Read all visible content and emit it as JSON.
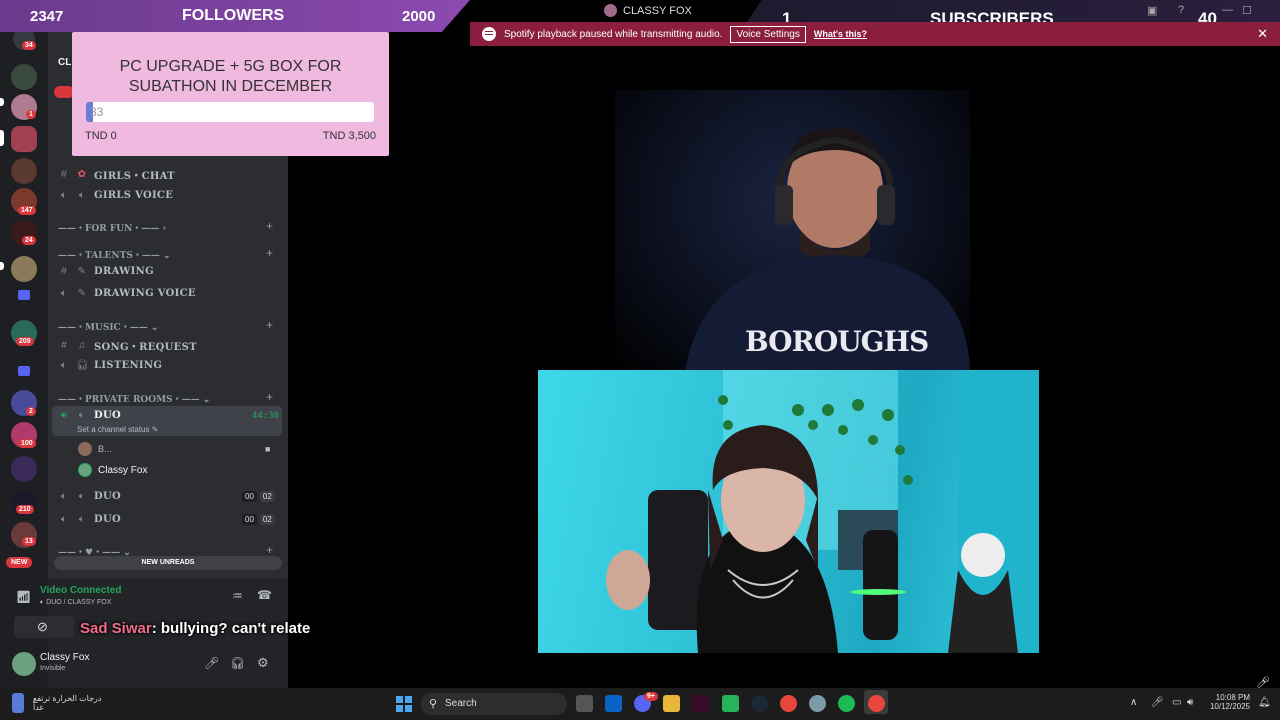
{
  "followers": {
    "current": "2347",
    "label": "FOLLOWERS",
    "goal": "2000"
  },
  "subscribers": {
    "current": "1",
    "label": "SUBSCRIBERS",
    "goal": "40"
  },
  "window": {
    "title": "CLASSY FOX"
  },
  "spotify_notice": {
    "text": "Spotify playback paused while transmitting audio.",
    "button": "Voice Settings",
    "link": "What's this?"
  },
  "goal": {
    "title_line1": "PC UPGRADE + 5G BOX FOR",
    "title_line2": "SUBATHON IN DECEMBER",
    "current": "33",
    "min_label": "TND 0",
    "max_label": "TND 3,500",
    "progress_fraction": 0.0094
  },
  "servers": {
    "badges": [
      "34",
      "1",
      "147",
      "24",
      "209",
      "2",
      "100",
      "210",
      "13",
      "NEW"
    ]
  },
  "channels": {
    "header_partial": "CL",
    "girls_chat": "GIRLS・CHAT",
    "girls_voice": "GIRLS VOICE",
    "cat_fun": "FOR FUN",
    "cat_talents": "TALENTS",
    "drawing": "DRAWING",
    "drawing_voice": "DRAWING VOICE",
    "cat_music": "MUSIC",
    "song_request": "SONG・REQUEST",
    "listening": "LISTENING",
    "cat_private": "PRIVATE ROOMS",
    "duo_active": "DUO",
    "duo_timer": "44:30",
    "duo_status": "Set a channel status",
    "member1": "B...",
    "member2": "Classy Fox",
    "duo2": "DUO",
    "duo2_count_a": "00",
    "duo2_count_b": "02",
    "duo3": "DUO",
    "duo3_count_a": "00",
    "duo3_count_b": "02",
    "new_unreads": "NEW UNREADS"
  },
  "voice": {
    "status": "Video Connected",
    "location": "DUO / CLASSY FOX"
  },
  "user": {
    "name": "Classy Fox",
    "status": "Invisible"
  },
  "chat_overlay": {
    "user": "Sad Siwar",
    "message": ": bullying? can't relate"
  },
  "webcam": {
    "shirt_text": "BOROUGHS"
  },
  "taskbar": {
    "weather_line1": "درجات الحرارة ترتفع",
    "weather_line2": "غداً",
    "search": "Search",
    "time": "10:08 PM",
    "date": "10/12/2025",
    "discord_badge": "9+"
  },
  "colors": {
    "discord_bg": "#2b2d31",
    "rail_bg": "#1e1f22",
    "notice_bg": "#8b1e3f",
    "goal_bg": "#f0b9e0",
    "voice_green": "#23a55a"
  }
}
